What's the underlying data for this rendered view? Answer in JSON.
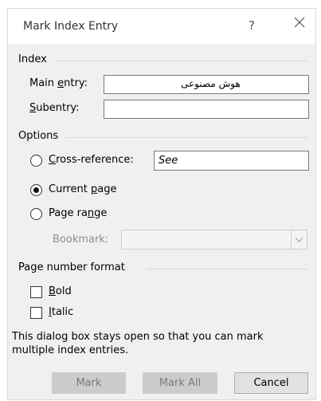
{
  "dialog": {
    "title": "Mark Index Entry",
    "help_glyph": "?",
    "close_label": "×"
  },
  "index": {
    "group_label": "Index",
    "main_entry_label_prefix": "Main ",
    "main_entry_label_accel": "e",
    "main_entry_label_suffix": "ntry:",
    "main_entry_value": "هوش مصنوعی",
    "subentry_label_accel": "S",
    "subentry_label_suffix": "ubentry:",
    "subentry_value": ""
  },
  "options": {
    "group_label": "Options",
    "cross_ref_accel": "C",
    "cross_ref_suffix": "ross-reference:",
    "cross_ref_value": "See",
    "current_page_prefix": "Current ",
    "current_page_accel": "p",
    "current_page_suffix": "age",
    "page_range_prefix": "Page ra",
    "page_range_accel": "n",
    "page_range_suffix": "ge",
    "selected": "current_page",
    "bookmark_label": "Bookmark:",
    "bookmark_value": ""
  },
  "page_number_format": {
    "group_label": "Page number format",
    "bold_accel": "B",
    "bold_suffix": "old",
    "bold_checked": false,
    "italic_accel": "I",
    "italic_suffix": "talic",
    "italic_checked": false
  },
  "info_text_line1": "This dialog box stays open so that you can mark",
  "info_text_line2": "multiple index entries.",
  "buttons": {
    "mark": "Mark",
    "mark_all": "Mark All",
    "cancel": "Cancel"
  }
}
